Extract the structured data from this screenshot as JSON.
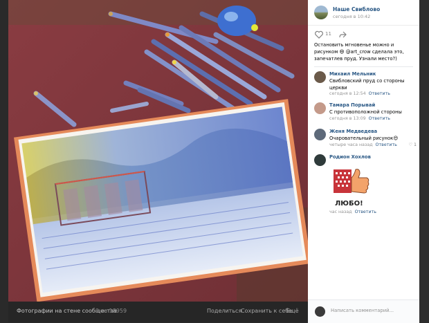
{
  "photo_footer": {
    "title": "Фотографии на стене сообщества",
    "count": "9 из 18959",
    "share": "Поделиться",
    "save": "Сохранить к себе",
    "more": "Ещё"
  },
  "post": {
    "group_name": "Наше Свиблово",
    "date": "сегодня в 10:42",
    "likes": "11",
    "text": "Остановить мгновенье можно и рисунком 😄 @art_crow сделала это, запечатлев пруд. Узнали место?)"
  },
  "comments": [
    {
      "name": "Михаил Мельник",
      "text": "Свибловский пруд со стороны церкви",
      "time": "сегодня в 12:54",
      "reply": "Ответить",
      "likes": ""
    },
    {
      "name": "Тамара Порывай",
      "text": "С противоположной стороны",
      "time": "сегодня в 13:09",
      "reply": "Ответить",
      "likes": ""
    },
    {
      "name": "Женя Медведева",
      "text": "Очаровательный рисунок😍",
      "time": "четыре часа назад",
      "reply": "Ответить",
      "likes": "1"
    },
    {
      "name": "Родион Хохлов",
      "text": "",
      "sticker_text": "ЛЮБО!",
      "time": "час назад",
      "reply": "Ответить",
      "likes": ""
    }
  ],
  "comment_input": {
    "placeholder": "Написать комментарий..."
  },
  "colors": {
    "link": "#2a5885",
    "meta": "#939393",
    "dark_bg": "#2e2e2e"
  }
}
